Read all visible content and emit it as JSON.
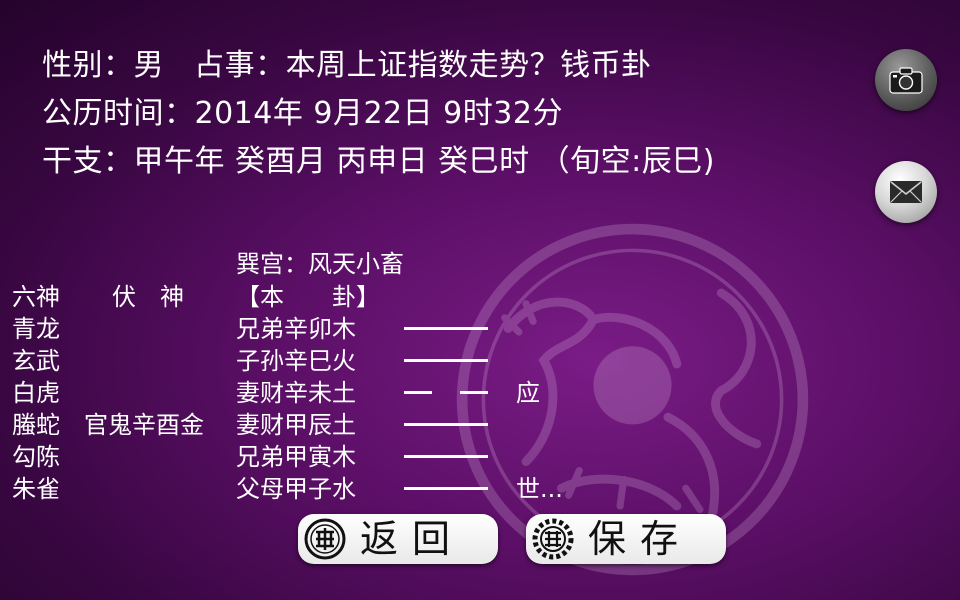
{
  "header": {
    "line1": "性别：男   占事：本周上证指数走势？钱币卦",
    "line2": "公历时间：2014年 9月22日 9时32分",
    "line3": "干支：甲午年 癸酉月 丙申日 癸巳时 （旬空:辰巳)"
  },
  "side_buttons": {
    "camera_icon": "camera-icon",
    "mail_icon": "mail-icon"
  },
  "gua": {
    "palace_title": "巽宫：风天小畜",
    "col_liushen": "六神",
    "col_fushen": "伏　神",
    "col_bengua": "【本　　卦】",
    "rows": [
      {
        "liushen": "青龙",
        "fushen": "",
        "yao": "兄弟辛卯木",
        "line": "yang",
        "mark": ""
      },
      {
        "liushen": "玄武",
        "fushen": "",
        "yao": "子孙辛巳火",
        "line": "yang",
        "mark": ""
      },
      {
        "liushen": "白虎",
        "fushen": "",
        "yao": "妻财辛未土",
        "line": "yin",
        "mark": "应"
      },
      {
        "liushen": "螣蛇",
        "fushen": "官鬼辛酉金",
        "yao": "妻财甲辰土",
        "line": "yang",
        "mark": ""
      },
      {
        "liushen": "勾陈",
        "fushen": "",
        "yao": "兄弟甲寅木",
        "line": "yang",
        "mark": ""
      },
      {
        "liushen": "朱雀",
        "fushen": "",
        "yao": "父母甲子水",
        "line": "yang",
        "mark": "世..."
      }
    ]
  },
  "buttons": {
    "back_label": "返回",
    "save_label": "保存"
  },
  "colors": {
    "background": "#5b0f66",
    "text": "#ffffff",
    "button_bg": "#ffffff"
  }
}
